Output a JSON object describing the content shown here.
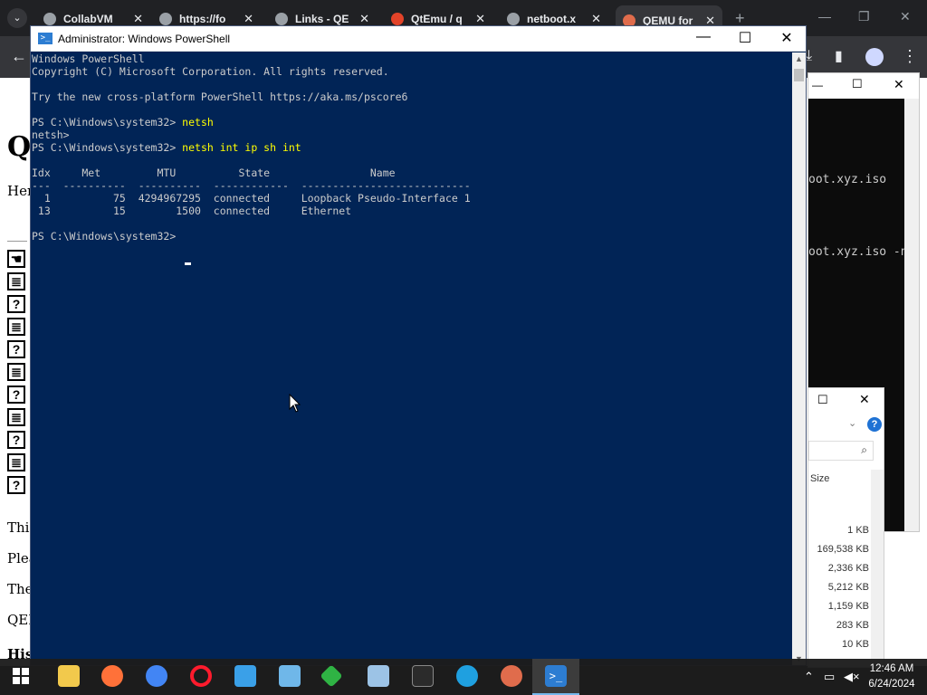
{
  "browser": {
    "tabs": [
      {
        "title": "CollabVM",
        "color": "#9aa0a6"
      },
      {
        "title": "https://fo",
        "color": "#9aa0a6"
      },
      {
        "title": "Links - QE",
        "color": "#9aa0a6"
      },
      {
        "title": "QtEmu / q",
        "color": "#e24329"
      },
      {
        "title": "netboot.x",
        "color": "#9aa0a6"
      },
      {
        "title": "QEMU for",
        "color": "#e06c4c"
      }
    ]
  },
  "background_page": {
    "heading_letter": "Q",
    "line_her": "Her",
    "line_this": "This",
    "line_plea": "Plea",
    "line_the": "The",
    "line_qem": "QEM",
    "line_his": "His"
  },
  "bg_terminal": {
    "line1": "oot.xyz.iso",
    "line2": "oot.xyz.iso -n"
  },
  "explorer": {
    "size_header": "Size",
    "sizes": [
      "1 KB",
      "169,538 KB",
      "2,336 KB",
      "5,212 KB",
      "1,159 KB",
      "283 KB",
      "10 KB"
    ]
  },
  "powershell": {
    "title": "Administrator: Windows PowerShell",
    "icon_text": ">_",
    "lines": [
      {
        "prefix": "Windows PowerShell",
        "cmd": ""
      },
      {
        "prefix": "Copyright (C) Microsoft Corporation. All rights reserved.",
        "cmd": ""
      },
      {
        "prefix": "",
        "cmd": ""
      },
      {
        "prefix": "Try the new cross-platform PowerShell https://aka.ms/pscore6",
        "cmd": ""
      },
      {
        "prefix": "",
        "cmd": ""
      },
      {
        "prefix": "PS C:\\Windows\\system32> ",
        "cmd": "netsh"
      },
      {
        "prefix": "netsh>",
        "cmd": ""
      },
      {
        "prefix": "PS C:\\Windows\\system32> ",
        "cmd": "netsh int ip sh int"
      },
      {
        "prefix": "",
        "cmd": ""
      },
      {
        "prefix": "Idx     Met         MTU          State                Name",
        "cmd": ""
      },
      {
        "prefix": "---  ----------  ----------  ------------  ---------------------------",
        "cmd": ""
      },
      {
        "prefix": "  1          75  4294967295  connected     Loopback Pseudo-Interface 1",
        "cmd": ""
      },
      {
        "prefix": " 13          15        1500  connected     Ethernet",
        "cmd": ""
      },
      {
        "prefix": "",
        "cmd": ""
      },
      {
        "prefix": "PS C:\\Windows\\system32> ",
        "cmd": ""
      }
    ]
  },
  "taskbar": {
    "apps": [
      {
        "name": "file-explorer",
        "color": "#f2c94c"
      },
      {
        "name": "firefox",
        "color": "#ff7139"
      },
      {
        "name": "chrome",
        "color": "#4285f4"
      },
      {
        "name": "opera",
        "color": "#ff1b2d"
      },
      {
        "name": "settings-app",
        "color": "#3aa0e8"
      },
      {
        "name": "control-panel",
        "color": "#6fb7e9"
      },
      {
        "name": "green-app",
        "color": "#2fb344"
      },
      {
        "name": "computer",
        "color": "#9cc3e6"
      },
      {
        "name": "terminal",
        "color": "#2b2b2b"
      },
      {
        "name": "edge",
        "color": "#1fa0e0"
      },
      {
        "name": "qemu",
        "color": "#e06c4c"
      },
      {
        "name": "powershell",
        "color": "#2d7dd2"
      }
    ],
    "time": "12:46 AM",
    "date": "6/24/2024"
  }
}
